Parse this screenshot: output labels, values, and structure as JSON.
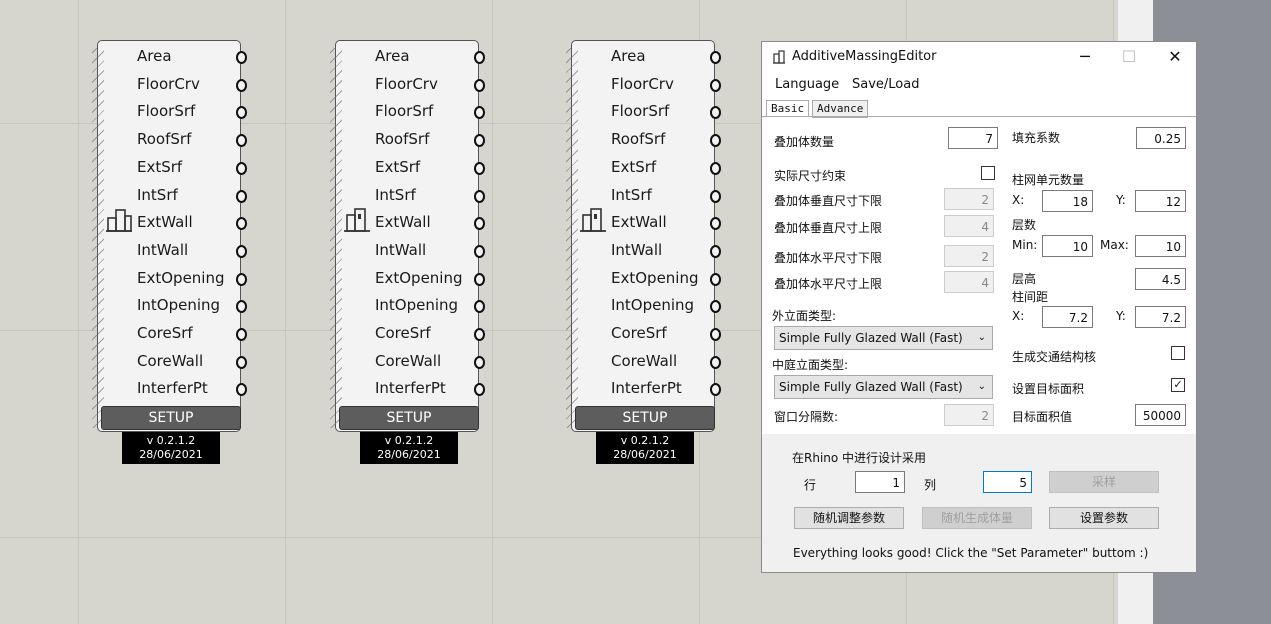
{
  "components": [
    {
      "outputs": [
        "Area",
        "FloorCrv",
        "FloorSrf",
        "RoofSrf",
        "ExtSrf",
        "IntSrf",
        "ExtWall",
        "IntWall",
        "ExtOpening",
        "IntOpening",
        "CoreSrf",
        "CoreWall",
        "InterferPt"
      ],
      "setup_label": "SETUP",
      "version": "v 0.2.1.2",
      "date": "28/06/2021",
      "icon": "buildings-icon"
    },
    {
      "outputs": [
        "Area",
        "FloorCrv",
        "FloorSrf",
        "RoofSrf",
        "ExtSrf",
        "IntSrf",
        "ExtWall",
        "IntWall",
        "ExtOpening",
        "IntOpening",
        "CoreSrf",
        "CoreWall",
        "InterferPt"
      ],
      "setup_label": "SETUP",
      "version": "v 0.2.1.2",
      "date": "28/06/2021",
      "icon": "building-icon"
    },
    {
      "outputs": [
        "Area",
        "FloorCrv",
        "FloorSrf",
        "RoofSrf",
        "ExtSrf",
        "IntSrf",
        "ExtWall",
        "IntWall",
        "ExtOpening",
        "IntOpening",
        "CoreSrf",
        "CoreWall",
        "InterferPt"
      ],
      "setup_label": "SETUP",
      "version": "v 0.2.1.2",
      "date": "28/06/2021",
      "icon": "building-icon"
    }
  ],
  "window": {
    "title": "AdditiveMassingEditor",
    "buttons": {
      "minimize": "─",
      "maximize": "☐",
      "close": "✕"
    },
    "menu": [
      "Language",
      "Save/Load"
    ],
    "tabs": [
      "Basic",
      "Advance"
    ],
    "left": {
      "count_label": "叠加体数量",
      "count_value": "7",
      "actual_size_label": "实际尺寸约束",
      "actual_size_checked": false,
      "vmin_label": "叠加体垂直尺寸下限",
      "vmin_value": "2",
      "vmax_label": "叠加体垂直尺寸上限",
      "vmax_value": "4",
      "hmin_label": "叠加体水平尺寸下限",
      "hmin_value": "2",
      "hmax_label": "叠加体水平尺寸上限",
      "hmax_value": "4",
      "facade_label": "外立面类型:",
      "facade_value": "Simple Fully Glazed Wall (Fast)",
      "atrium_label": "中庭立面类型:",
      "atrium_value": "Simple Fully Glazed Wall (Fast)",
      "window_div_label": "窗口分隔数:",
      "window_div_value": "2"
    },
    "right": {
      "fill_label": "填充系数",
      "fill_value": "0.25",
      "grid_label": "柱网单元数量",
      "grid_x_label": "X:",
      "grid_x_value": "18",
      "grid_y_label": "Y:",
      "grid_y_value": "12",
      "floors_label": "层数",
      "floors_min_label": "Min:",
      "floors_min_value": "10",
      "floors_max_label": "Max:",
      "floors_max_value": "10",
      "height_label": "层高",
      "height_value": "4.5",
      "spacing_label": "柱间距",
      "spacing_x_label": "X:",
      "spacing_x_value": "7.2",
      "spacing_y_label": "Y:",
      "spacing_y_value": "7.2",
      "core_label": "生成交通结构核",
      "core_checked": false,
      "target_label": "设置目标面积",
      "target_checked": true,
      "target_value_label": "目标面积值",
      "target_value": "50000"
    },
    "bottom": {
      "rhino_label": "在Rhino 中进行设计采用",
      "row_label": "行",
      "row_value": "1",
      "col_label": "列",
      "col_value": "5",
      "sample_button": "采样",
      "random_adjust_button": "随机调整参数",
      "random_gen_button": "随机生成体量",
      "set_param_button": "设置参数",
      "status": "Everything looks good! Click the \"Set Parameter\" buttom :)"
    }
  }
}
